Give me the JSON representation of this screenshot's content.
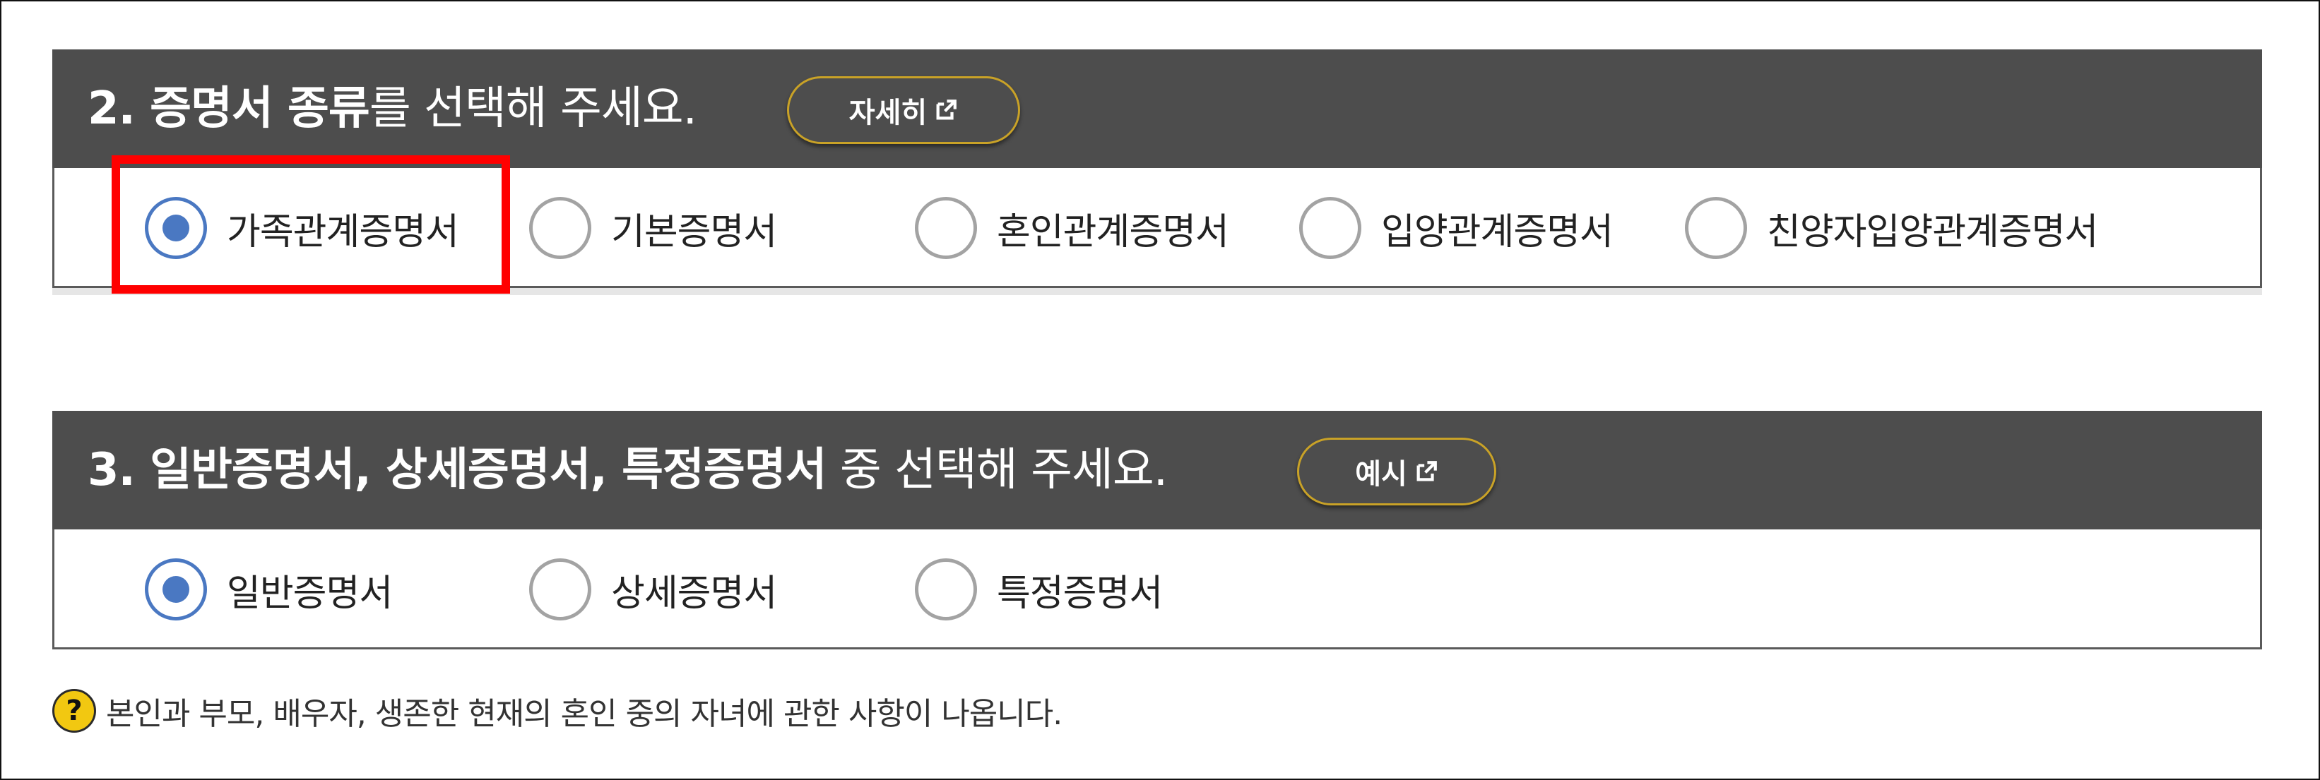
{
  "section2": {
    "title_strong_1": "2. 증명서 종류",
    "title_normal": "를 선택해 주세요.",
    "detail_button_label": "자세히",
    "options": [
      {
        "label": "가족관계증명서",
        "checked": true
      },
      {
        "label": "기본증명서",
        "checked": false
      },
      {
        "label": "혼인관계증명서",
        "checked": false
      },
      {
        "label": "입양관계증명서",
        "checked": false
      },
      {
        "label": "친양자입양관계증명서",
        "checked": false
      }
    ]
  },
  "section3": {
    "title_strong": "3. 일반증명서, 상세증명서, 특정증명서",
    "title_normal": " 중 선택해 주세요.",
    "example_button_label": "예시",
    "options": [
      {
        "label": "일반증명서",
        "checked": true
      },
      {
        "label": "상세증명서",
        "checked": false
      },
      {
        "label": "특정증명서",
        "checked": false
      }
    ]
  },
  "note": {
    "icon": "question-icon",
    "text": "본인과 부모, 배우자, 생존한 현재의 혼인 중의 자녀에 관한 사항이 나옵니다."
  },
  "colors": {
    "header_bg": "#4d4d4d",
    "button_border": "#c9a227",
    "radio_checked": "#4a78c2",
    "highlight": "#ff0000",
    "help_icon_bg": "#f2c811"
  }
}
